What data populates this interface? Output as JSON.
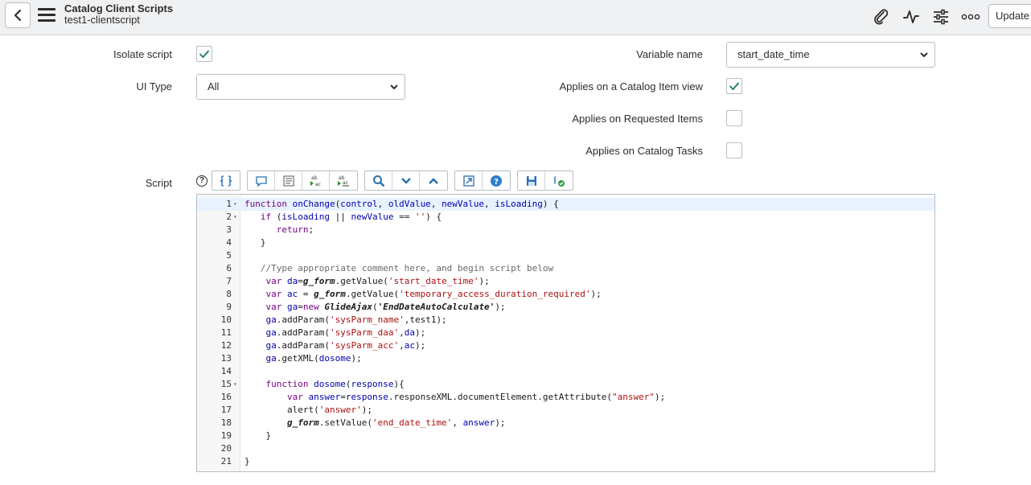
{
  "header": {
    "title": "Catalog Client Scripts",
    "subtitle": "test1-clientscript",
    "update_label": "Update"
  },
  "form": {
    "isolate_script": {
      "label": "Isolate script",
      "checked": true
    },
    "ui_type": {
      "label": "UI Type",
      "value": "All"
    },
    "variable_name": {
      "label": "Variable name",
      "value": "start_date_time"
    },
    "applies_catalog_item": {
      "label": "Applies on a Catalog Item view",
      "checked": true
    },
    "applies_requested": {
      "label": "Applies on Requested Items",
      "checked": false
    },
    "applies_tasks": {
      "label": "Applies on Catalog Tasks",
      "checked": false
    },
    "script_label": "Script",
    "help_glyph": "?"
  },
  "toolbar": {
    "icons": [
      "format-code-icon",
      "comment-icon",
      "format-text-icon",
      "replace-icon",
      "replace-all-icon",
      "search-icon",
      "next-icon",
      "previous-icon",
      "fullscreen-icon",
      "help-icon",
      "save-icon",
      "validate-icon"
    ]
  },
  "editor": {
    "lines": [
      {
        "n": "1",
        "fold": true,
        "code": "function onChange(control, oldValue, newValue, isLoading) {"
      },
      {
        "n": "2",
        "fold": true,
        "code": "   if (isLoading || newValue == '') {"
      },
      {
        "n": "3",
        "fold": false,
        "code": "      return;"
      },
      {
        "n": "4",
        "fold": false,
        "code": "   }"
      },
      {
        "n": "5",
        "fold": false,
        "code": ""
      },
      {
        "n": "6",
        "fold": false,
        "code": "   //Type appropriate comment here, and begin script below"
      },
      {
        "n": "7",
        "fold": false,
        "code": "    var da=g_form.getValue('start_date_time');"
      },
      {
        "n": "8",
        "fold": false,
        "code": "    var ac = g_form.getValue('temporary_access_duration_required');"
      },
      {
        "n": "9",
        "fold": false,
        "code": "    var ga=new GlideAjax('EndDateAutoCalculate');"
      },
      {
        "n": "10",
        "fold": false,
        "code": "    ga.addParam('sysParm_name',test1);"
      },
      {
        "n": "11",
        "fold": false,
        "code": "    ga.addParam('sysParm_daa',da);"
      },
      {
        "n": "12",
        "fold": false,
        "code": "    ga.addParam('sysParm_acc',ac);"
      },
      {
        "n": "13",
        "fold": false,
        "code": "    ga.getXML(dosome);"
      },
      {
        "n": "14",
        "fold": false,
        "code": ""
      },
      {
        "n": "15",
        "fold": true,
        "code": "    function dosome(response){"
      },
      {
        "n": "16",
        "fold": false,
        "code": "        var answer=response.responseXML.documentElement.getAttribute(\"answer\");"
      },
      {
        "n": "17",
        "fold": false,
        "code": "        alert('answer');"
      },
      {
        "n": "18",
        "fold": false,
        "code": "        g_form.setValue('end_date_time', answer);"
      },
      {
        "n": "19",
        "fold": false,
        "code": "    }"
      },
      {
        "n": "20",
        "fold": false,
        "code": ""
      },
      {
        "n": "21",
        "fold": false,
        "code": "}"
      }
    ]
  }
}
